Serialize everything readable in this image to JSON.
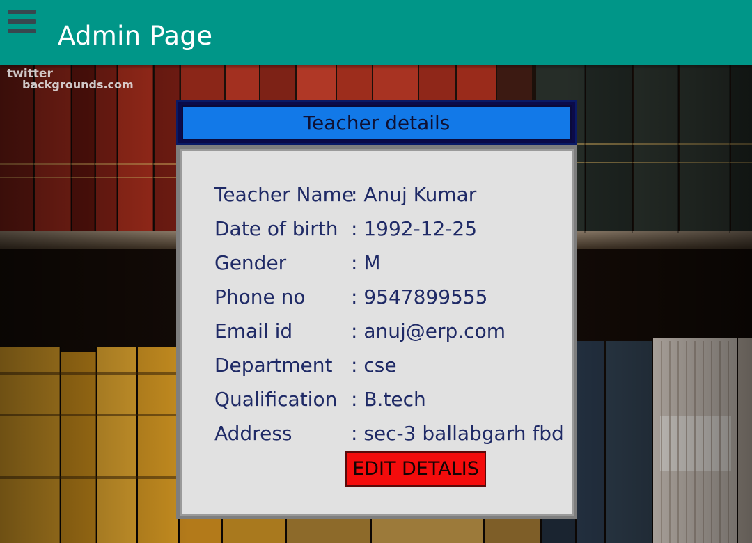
{
  "appbar": {
    "title": "Admin Page",
    "menu_icon": "hamburger-menu-icon",
    "color": "#009688"
  },
  "watermark": {
    "line1": "twitter",
    "line2": "backgrounds.com"
  },
  "dialog": {
    "header": "Teacher details",
    "fields": [
      {
        "label": "Teacher Name",
        "value": ": Anuj Kumar"
      },
      {
        "label": "Date of birth",
        "value": ": 1992-12-25"
      },
      {
        "label": "Gender",
        "value": ": M"
      },
      {
        "label": "Phone no",
        "value": ": 9547899555"
      },
      {
        "label": "Email id",
        "value": ": anuj@erp.com"
      },
      {
        "label": "Department",
        "value": ": cse"
      },
      {
        "label": "Qualification",
        "value": ": B.tech"
      },
      {
        "label": "Address",
        "value": ": sec-3 ballabgarh fbd"
      }
    ],
    "edit_button": "EDIT DETALIS"
  },
  "colors": {
    "header_blue": "#1279e8",
    "button_red": "#f40c0c",
    "text_navy": "#1f2a66"
  }
}
